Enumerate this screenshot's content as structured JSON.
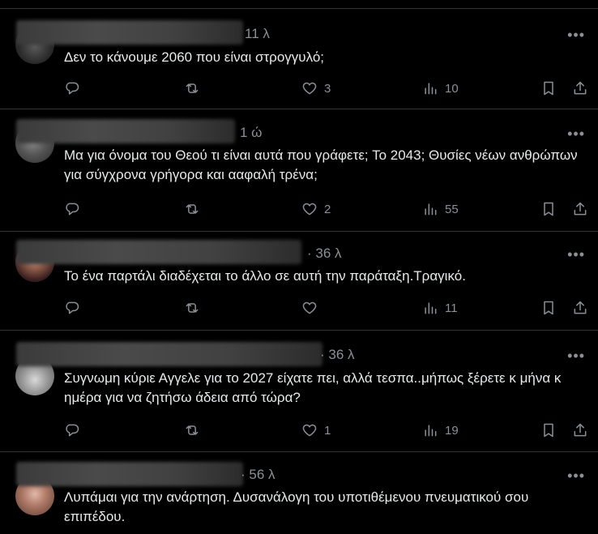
{
  "replies": [
    {
      "time": "11 λ",
      "text": "Δεν το κάνουμε 2060 που είναι στρογγυλό;",
      "replies": "",
      "reposts": "",
      "likes": "3",
      "views": "10"
    },
    {
      "time": "1 ώ",
      "text": "Μα για όνομα του Θεού τι είναι αυτά που γράφετε; Το 2043; Θυσίες νέων ανθρώπων για σύγχρονα γρήγορα και ααφαλή τρένα;",
      "replies": "",
      "reposts": "",
      "likes": "2",
      "views": "55"
    },
    {
      "time": "· 36 λ",
      "text": "Το ένα παρτάλι διαδέχεται το άλλο σε αυτή την παράταξη.Τραγικό.",
      "replies": "",
      "reposts": "",
      "likes": "",
      "views": "11"
    },
    {
      "time": "· 36 λ",
      "text": "Συγνωμη κύριε Αγγελε για το 2027 είχατε πει,  αλλά τεσπα..μήπως ξέρετε κ μήνα κ ημέρα για να ζητήσω άδεια από τώρα?",
      "replies": "",
      "reposts": "",
      "likes": "1",
      "views": "19"
    },
    {
      "time": "· 56 λ",
      "text": "Λυπάμαι για την ανάρτηση. Δυσανάλογη του υποτιθέμενου πνευματικού σου επιπέδου.",
      "replies": "",
      "reposts": "",
      "likes": "",
      "views": ""
    }
  ],
  "more_glyph": "•••",
  "colors": {
    "background": "#000000",
    "text": "#e7e9ea",
    "muted": "#8b9096",
    "divider": "#2f3336"
  },
  "icons": [
    "reply-icon",
    "repost-icon",
    "like-icon",
    "views-icon",
    "bookmark-icon",
    "share-icon",
    "more-icon"
  ]
}
